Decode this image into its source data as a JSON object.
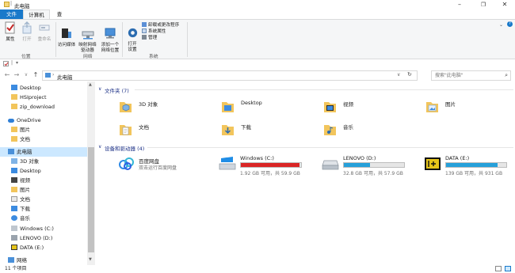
{
  "window": {
    "title": "此电脑"
  },
  "tabs": [
    "文件",
    "计算机",
    "查看"
  ],
  "ribbon": {
    "location": {
      "label": "位置",
      "buttons": [
        "属性",
        "打开",
        "重命名"
      ]
    },
    "network": {
      "label": "网络",
      "buttons": [
        "访问媒体",
        "映射网络\n驱动器",
        "添加一个\n网络位置"
      ]
    },
    "system": {
      "label": "系统",
      "open_settings": "打开\n设置",
      "items": [
        "卸载或更改程序",
        "系统属性",
        "管理"
      ]
    }
  },
  "address": {
    "path": "此电脑",
    "search_placeholder": "搜索\"此电脑\""
  },
  "nav": {
    "items": [
      {
        "label": "Desktop",
        "icon": "folder-blue-icon"
      },
      {
        "label": "HSIproject",
        "icon": "folder-icon"
      },
      {
        "label": "zip_download",
        "icon": "folder-icon"
      },
      {
        "label": "OneDrive",
        "icon": "cloud-icon"
      },
      {
        "label": "图片",
        "icon": "folder-icon"
      },
      {
        "label": "文档",
        "icon": "folder-icon"
      },
      {
        "label": "此电脑",
        "icon": "computer-icon"
      },
      {
        "label": "3D 对象",
        "icon": "3d-folder-icon"
      },
      {
        "label": "Desktop",
        "icon": "folder-blue-icon"
      },
      {
        "label": "视频",
        "icon": "video-folder-icon"
      },
      {
        "label": "图片",
        "icon": "pictures-folder-icon"
      },
      {
        "label": "文档",
        "icon": "documents-folder-icon"
      },
      {
        "label": "下载",
        "icon": "downloads-folder-icon"
      },
      {
        "label": "音乐",
        "icon": "music-folder-icon"
      },
      {
        "label": "Windows (C:)",
        "icon": "windows-drive-icon"
      },
      {
        "label": "LENOVO (D:)",
        "icon": "drive-icon"
      },
      {
        "label": "DATA (E:)",
        "icon": "data-drive-icon"
      },
      {
        "label": "网络",
        "icon": "network-icon"
      }
    ]
  },
  "content": {
    "folders_header": "文件夹 (7)",
    "folders": [
      "3D 对象",
      "Desktop",
      "视频",
      "图片",
      "文档",
      "下载",
      "音乐"
    ],
    "drives_header": "设备和驱动器 (4)",
    "baidu": {
      "name": "百度网盘",
      "desc": "双击运行百度网盘"
    },
    "drives": [
      {
        "name": "Windows (C:)",
        "info": "1.92 GB 可用，共 59.9 GB",
        "used_fraction": 0.968,
        "color": "#da2626"
      },
      {
        "name": "LENOVO (D:)",
        "info": "32.8 GB 可用，共 57.9 GB",
        "used_fraction": 0.433,
        "color": "#26a0da"
      },
      {
        "name": "DATA (E:)",
        "info": "139 GB 可用，共 931 GB",
        "used_fraction": 0.851,
        "color": "#26a0da"
      }
    ]
  },
  "status": {
    "count": "11 个项目"
  },
  "colors": {
    "accent": "#1979ca",
    "selection": "#cce8ff",
    "folder": "#f2c55c"
  }
}
